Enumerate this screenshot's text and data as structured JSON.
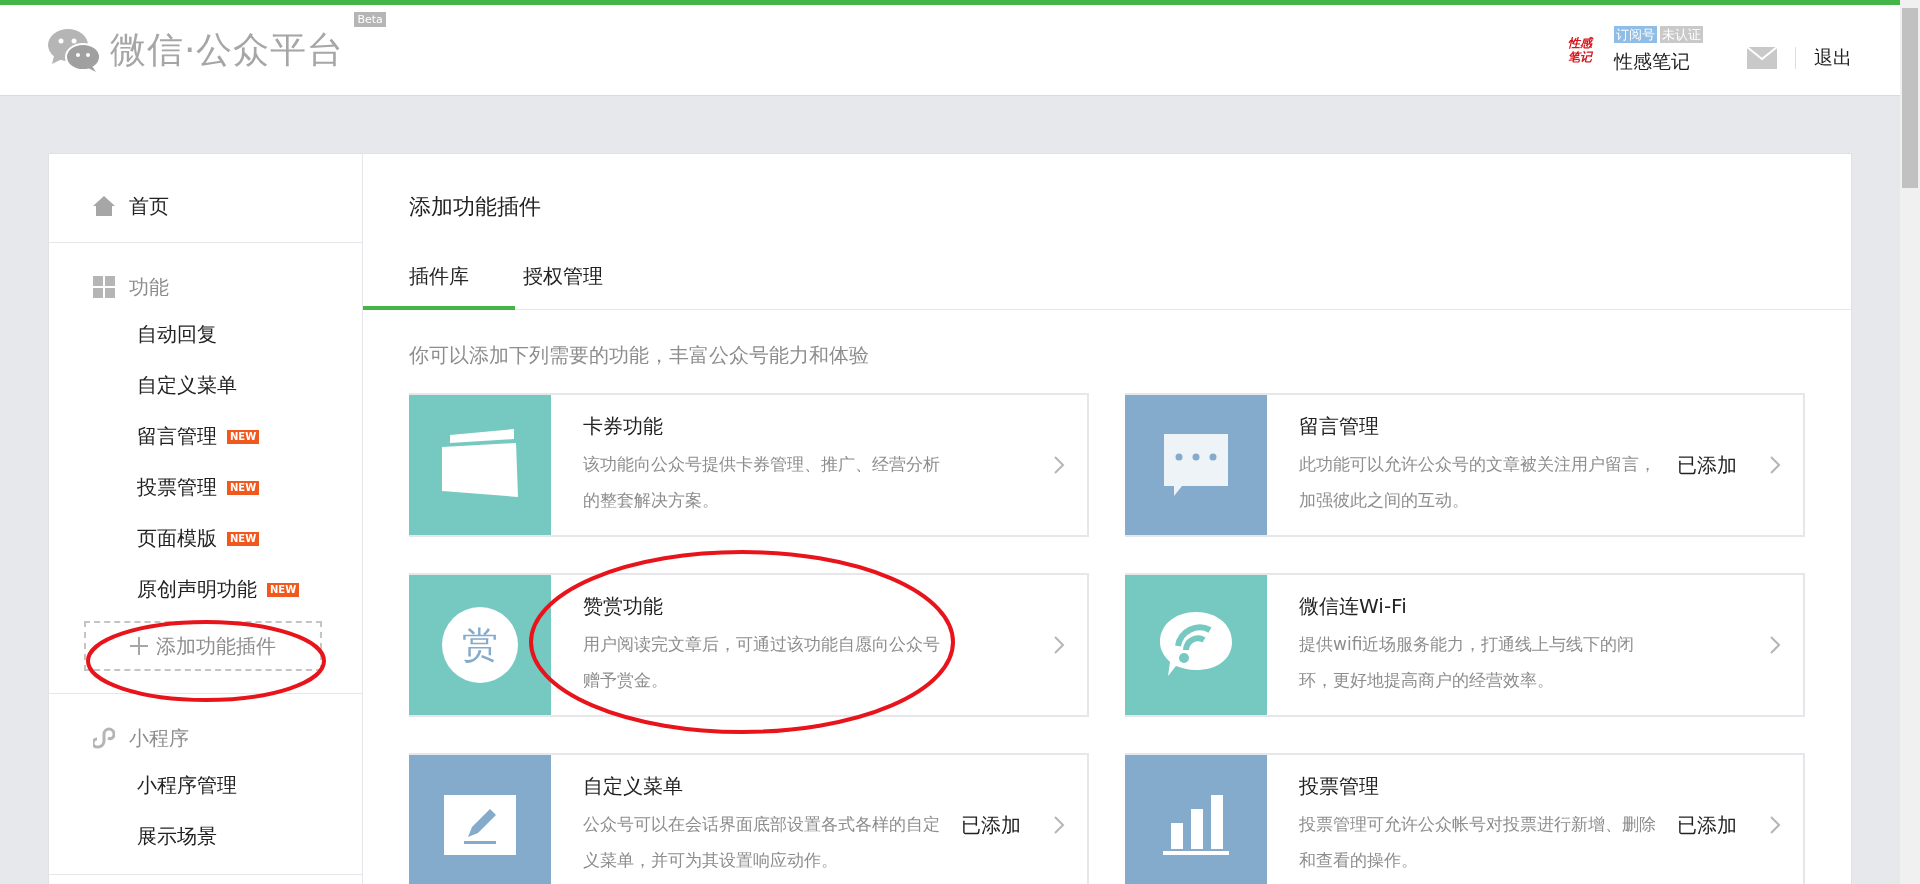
{
  "header": {
    "logo_text": "微信·公众平台",
    "beta_badge": "Beta",
    "account": {
      "avatar_lines": [
        "性感",
        "笔记"
      ],
      "tags": [
        {
          "label": "订阅号",
          "color": "#8fbde6"
        },
        {
          "label": "未认证",
          "color": "#c9c9c9"
        }
      ],
      "name": "性感笔记"
    },
    "logout": "退出"
  },
  "sidebar": {
    "sections": [
      {
        "title": "首页"
      },
      {
        "title": "功能",
        "items": [
          {
            "label": "自动回复"
          },
          {
            "label": "自定义菜单"
          },
          {
            "label": "留言管理",
            "badge": "NEW"
          },
          {
            "label": "投票管理",
            "badge": "NEW"
          },
          {
            "label": "页面模版",
            "badge": "NEW"
          },
          {
            "label": "原创声明功能",
            "badge": "NEW"
          }
        ],
        "add_button": "添加功能插件"
      },
      {
        "title": "小程序",
        "items": [
          {
            "label": "小程序管理"
          },
          {
            "label": "展示场景"
          }
        ]
      }
    ]
  },
  "content": {
    "title": "添加功能插件",
    "tabs": [
      {
        "label": "插件库",
        "selected": true
      },
      {
        "label": "授权管理",
        "selected": false
      }
    ],
    "intro": "你可以添加下列需要的功能，丰富公众号能力和体验",
    "plugins": [
      {
        "kind": "card",
        "color": "#76c9c1",
        "name": "卡券功能",
        "description": "该功能向公众号提供卡券管理、推广、经营分析的整套解决方案。"
      },
      {
        "kind": "message",
        "color": "#84abcc",
        "name": "留言管理",
        "description": "此功能可以允许公众号的文章被关注用户留言，加强彼此之间的互动。",
        "status": "已添加"
      },
      {
        "kind": "reward",
        "color": "#76c9c1",
        "icon_text": "赏",
        "name": "赞赏功能",
        "description": "用户阅读完文章后，可通过该功能自愿向公众号赠予赏金。"
      },
      {
        "kind": "wifi",
        "color": "#76c9c1",
        "name": "微信连Wi-Fi",
        "description": "提供wifi近场服务能力，打通线上与线下的闭环，更好地提高商户的经营效率。"
      },
      {
        "kind": "edit",
        "color": "#84abcc",
        "name": "自定义菜单",
        "description": "公众号可以在会话界面底部设置各式各样的自定义菜单，并可为其设置响应动作。",
        "status": "已添加"
      },
      {
        "kind": "chart",
        "color": "#84abcc",
        "name": "投票管理",
        "description": "投票管理可允许公众帐号对投票进行新增、删除和查看的操作。",
        "status": "已添加"
      }
    ]
  }
}
